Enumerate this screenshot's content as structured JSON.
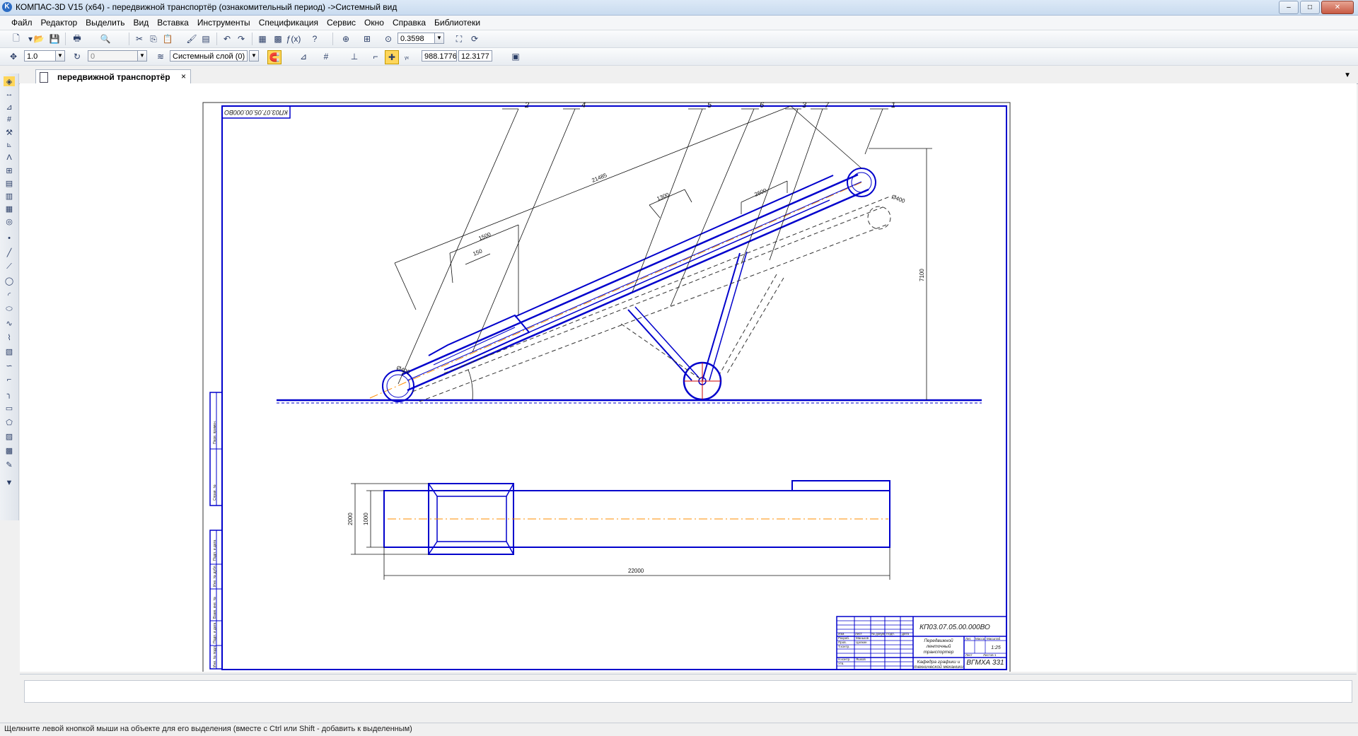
{
  "window": {
    "title": "КОМПАС-3D V15 (x64) - передвижной транспортёр (ознакомительный период) ->Системный вид",
    "app_icon": "K",
    "minimize": "–",
    "maximize": "□",
    "close": "✕"
  },
  "menu": [
    "Файл",
    "Редактор",
    "Выделить",
    "Вид",
    "Вставка",
    "Инструменты",
    "Спецификация",
    "Сервис",
    "Окно",
    "Справка",
    "Библиотеки"
  ],
  "toolbar1": {
    "zoom_value": "0.3598"
  },
  "toolbar2": {
    "step_value": "1.0",
    "angle_value": "0",
    "layer_value": "Системный слой (0)",
    "coord_x": "988.1776",
    "coord_y": "12.3177"
  },
  "tab": {
    "label": "передвижной транспортёр",
    "close": "×"
  },
  "drawing": {
    "stamp_top": "КП03.07.05.00.000ВО",
    "leaders": [
      "2",
      "4",
      "5",
      "6",
      "3",
      "7",
      "1"
    ],
    "dimensions": {
      "total_length": "21485",
      "d400_left": "Ø400",
      "d400_right": "Ø400",
      "d1500": "1500",
      "d150": "150",
      "d1300": "1300",
      "d2600": "2600",
      "height": "7100",
      "plan_length": "22000",
      "plan_width_outer": "2000",
      "plan_width_inner": "1000"
    },
    "titleblock": {
      "code": "КП03.07.05.00.000ВО",
      "name_line1": "Передвижной",
      "name_line2": "ленточный",
      "name_line3": "транспортер",
      "scale": "1:25",
      "dept_line1": "Кафедра графики и",
      "dept_line2": "технической механики",
      "org": "ВГМХА 331",
      "role_dev": "Разраб.",
      "role_check": "Пров.",
      "role_approve": "Утв.",
      "role_tech": "Т.контр.",
      "role_norm": "Н.контр.",
      "col_izm": "Изм.",
      "col_list": "Лист",
      "col_doc": "№ докум.",
      "col_sign": "Подп.",
      "col_date": "Дата",
      "person1": "Маньков",
      "person2": "Цалкин",
      "person3": "Яшков",
      "lit": "Лит.",
      "mass": "Масса",
      "masht": "Масштаб",
      "sheet": "Лист",
      "sheets": "Листов 1"
    },
    "side_cells": [
      "Подп. и дата",
      "Инв. № дубл.",
      "Взам. инв. №",
      "Подп. и дата",
      "Инв. № подл.",
      "Перв. примен.",
      "Справ. №"
    ]
  },
  "status": {
    "hint": "Щелкните левой кнопкой мыши на объекте для его выделения (вместе с Ctrl или Shift - добавить к выделенным)"
  },
  "icons": {
    "new": "new-document-icon",
    "open": "open-folder-icon",
    "save": "save-icon",
    "print": "print-icon"
  },
  "colors": {
    "line": "#0000cc",
    "axis": "#ff8c00",
    "text": "#1a1a1a"
  }
}
